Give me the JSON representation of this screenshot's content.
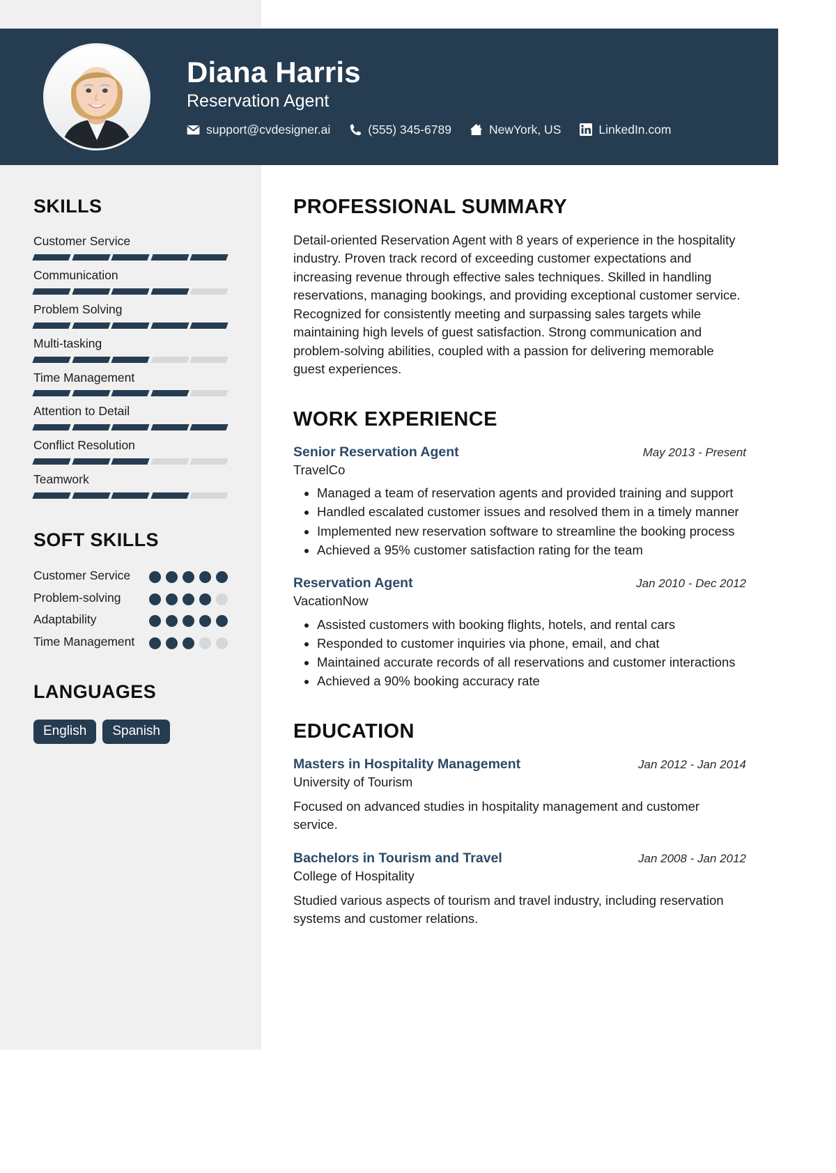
{
  "colors": {
    "header_bg": "#263c51",
    "sidebar_bg": "#f0f0f0",
    "accent": "#2c4a68",
    "bar_filled": "#263c51",
    "bar_empty": "#d8d8d8"
  },
  "header": {
    "name": "Diana Harris",
    "role": "Reservation Agent",
    "contacts": [
      {
        "icon": "envelope-icon",
        "text": "support@cvdesigner.ai"
      },
      {
        "icon": "phone-icon",
        "text": "(555) 345-6789"
      },
      {
        "icon": "home-icon",
        "text": "NewYork, US"
      },
      {
        "icon": "linkedin-icon",
        "text": "LinkedIn.com"
      }
    ]
  },
  "sidebar": {
    "skills_heading": "SKILLS",
    "skills": [
      {
        "name": "Customer Service",
        "level": 5,
        "max": 5
      },
      {
        "name": "Communication",
        "level": 4,
        "max": 5
      },
      {
        "name": "Problem Solving",
        "level": 5,
        "max": 5
      },
      {
        "name": "Multi-tasking",
        "level": 3,
        "max": 5
      },
      {
        "name": "Time Management",
        "level": 4,
        "max": 5
      },
      {
        "name": "Attention to Detail",
        "level": 5,
        "max": 5
      },
      {
        "name": "Conflict Resolution",
        "level": 3,
        "max": 5
      },
      {
        "name": "Teamwork",
        "level": 4,
        "max": 5
      }
    ],
    "soft_skills_heading": "SOFT SKILLS",
    "soft_skills": [
      {
        "name": "Customer Service",
        "level": 5,
        "max": 5
      },
      {
        "name": "Problem-solving",
        "level": 4,
        "max": 5
      },
      {
        "name": "Adaptability",
        "level": 5,
        "max": 5
      },
      {
        "name": "Time Management",
        "level": 3,
        "max": 5
      }
    ],
    "languages_heading": "LANGUAGES",
    "languages": [
      "English",
      "Spanish"
    ]
  },
  "main": {
    "summary_heading": "PROFESSIONAL SUMMARY",
    "summary_text": "Detail-oriented Reservation Agent with 8 years of experience in the hospitality industry. Proven track record of exceeding customer expectations and increasing revenue through effective sales techniques. Skilled in handling reservations, managing bookings, and providing exceptional customer service. Recognized for consistently meeting and surpassing sales targets while maintaining high levels of guest satisfaction. Strong communication and problem-solving abilities, coupled with a passion for delivering memorable guest experiences.",
    "experience_heading": "WORK EXPERIENCE",
    "experience": [
      {
        "title": "Senior Reservation Agent",
        "date": "May 2013 - Present",
        "org": "TravelCo",
        "bullets": [
          "Managed a team of reservation agents and provided training and support",
          "Handled escalated customer issues and resolved them in a timely manner",
          "Implemented new reservation software to streamline the booking process",
          "Achieved a 95% customer satisfaction rating for the team"
        ]
      },
      {
        "title": "Reservation Agent",
        "date": "Jan 2010 - Dec 2012",
        "org": "VacationNow",
        "bullets": [
          "Assisted customers with booking flights, hotels, and rental cars",
          "Responded to customer inquiries via phone, email, and chat",
          "Maintained accurate records of all reservations and customer interactions",
          "Achieved a 90% booking accuracy rate"
        ]
      }
    ],
    "education_heading": "EDUCATION",
    "education": [
      {
        "degree": "Masters in Hospitality Management",
        "date": "Jan 2012 - Jan 2014",
        "school": "University of Tourism",
        "description": "Focused on advanced studies in hospitality management and customer service."
      },
      {
        "degree": "Bachelors in Tourism and Travel",
        "date": "Jan 2008 - Jan 2012",
        "school": "College of Hospitality",
        "description": "Studied various aspects of tourism and travel industry, including reservation systems and customer relations."
      }
    ]
  }
}
